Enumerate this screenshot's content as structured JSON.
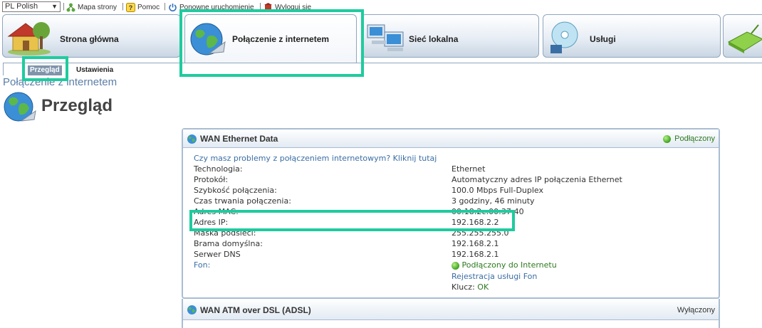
{
  "topbar": {
    "language": "PL Polish",
    "links": {
      "sitemap": "Mapa strony",
      "help": "Pomoc",
      "restart": "Ponowne uruchomienie",
      "logout": "Wyloguj się"
    }
  },
  "nav": {
    "tabs": [
      {
        "label": "Strona główna",
        "icon": "house-icon"
      },
      {
        "label": "Połączenie z internetem",
        "icon": "globe-icon",
        "active": true
      },
      {
        "label": "Sieć lokalna",
        "icon": "computers-icon"
      },
      {
        "label": "Usługi",
        "icon": "disc-icon"
      },
      {
        "label": "",
        "icon": "router-icon"
      }
    ]
  },
  "subnav": {
    "tabs": [
      {
        "label": "Przegląd",
        "active": true
      },
      {
        "label": "Ustawienia"
      }
    ]
  },
  "page": {
    "breadcrumb": "Połączenie z internetem",
    "title": "Przegląd"
  },
  "wan_ethernet": {
    "title": "WAN Ethernet Data",
    "status": "Podłączony",
    "help_link": "Czy masz problemy z połączeniem internetowym? Kliknij tutaj",
    "rows": [
      {
        "label": "Technologia:",
        "value": "Ethernet"
      },
      {
        "label": "Protokół:",
        "value": "Automatyczny adres IP połączenia Ethernet"
      },
      {
        "label": "Szybkość połączenia:",
        "value": "100.0 Mbps Full-Duplex"
      },
      {
        "label": "Czas trwania połączenia:",
        "value": "3 godziny, 46 minuty"
      },
      {
        "label": "Adres MAC:",
        "value": "00:18:2c:00:37:40"
      },
      {
        "label": "Adres IP:",
        "value": "192.168.2.2"
      },
      {
        "label": "Maska podsieci:",
        "value": "255.255.255.0"
      },
      {
        "label": "Brama domyślna:",
        "value": "192.168.2.1"
      },
      {
        "label": "Serwer DNS",
        "value": "192.168.2.1"
      }
    ],
    "fon": {
      "label": "Fon:",
      "status": "Podłączony do Internetu",
      "register_link": "Rejestracja usługi Fon",
      "key_label": "Klucz:",
      "key_value": "OK"
    }
  },
  "wan_dsl": {
    "title": "WAN ATM over DSL (ADSL)",
    "status": "Wyłączony"
  },
  "colors": {
    "highlight": "#1fcb9e",
    "link": "#3b6ea5",
    "status_ok": "#2d7a1f",
    "panel_border": "#a9bdd2"
  }
}
